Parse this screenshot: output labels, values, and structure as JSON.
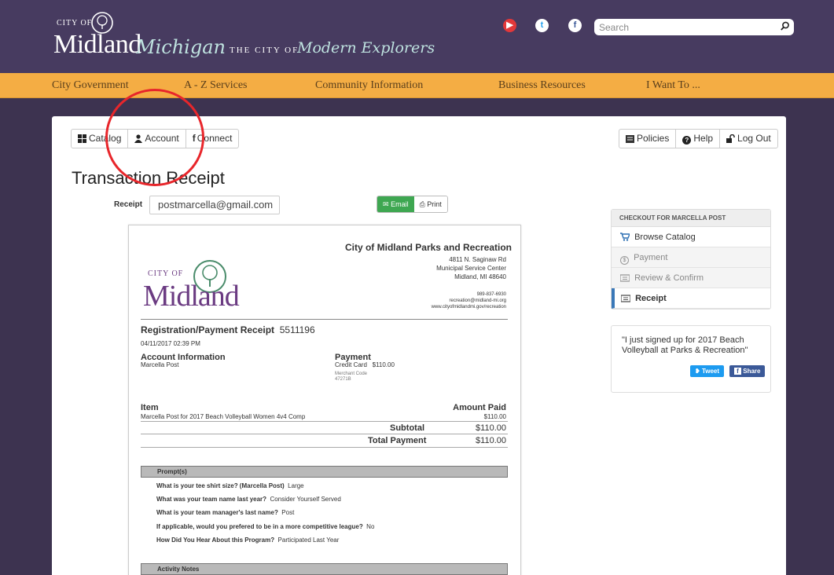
{
  "header": {
    "logo_cityof": "CITY OF",
    "logo_word": "Midland",
    "logo_script1": "Michigan",
    "logo_theof": "THE CITY OF",
    "logo_script2": "Modern Explorers",
    "social": [
      "youtube-icon",
      "twitter-icon",
      "facebook-icon"
    ],
    "search_placeholder": "Search"
  },
  "nav": {
    "items": [
      {
        "label": "City Government"
      },
      {
        "label": "A - Z Services"
      },
      {
        "label": "Community Information"
      },
      {
        "label": "Business Resources"
      },
      {
        "label": "I Want To ..."
      }
    ]
  },
  "toolbar": {
    "catalog": "Catalog",
    "account": "Account",
    "connect": "Connect",
    "policies": "Policies",
    "help": "Help",
    "logout": "Log Out"
  },
  "page": {
    "title": "Transaction Receipt",
    "receipt_label": "Receipt",
    "receipt_email": "postmarcella@gmail.com",
    "email_btn": "Email",
    "print_btn": "Print"
  },
  "doc": {
    "org_name": "City of Midland Parks and Recreation",
    "logo_cityof": "CITY OF",
    "logo_word": "Midland",
    "address": [
      "4811 N. Saginaw Rd",
      "Municipal Service Center",
      "Midland, MI 48640"
    ],
    "contact": [
      "989-837-6930",
      "recreation@midland-mi.org",
      "www.cityofmidlandmi.gov/recreation"
    ],
    "reg_title": "Registration/Payment Receipt",
    "reg_number": "5511196",
    "datetime": "04/11/2017 02:39 PM",
    "account_info_label": "Account Information",
    "account_name": "Marcella Post",
    "payment_label": "Payment",
    "payment_method": "Credit Card",
    "payment_amount": "$110.00",
    "merchant_code_label": "Merchant Code",
    "merchant_code": "47271B",
    "item_label": "Item",
    "amount_paid_label": "Amount Paid",
    "item_desc": "Marcella Post for 2017 Beach Volleyball Women 4v4 Comp",
    "item_amount": "$110.00",
    "subtotal_label": "Subtotal",
    "subtotal": "$110.00",
    "total_label": "Total Payment",
    "total": "$110.00",
    "prompts_label": "Prompt(s)",
    "prompts": [
      {
        "q": "What is your tee shirt size? (Marcella Post)",
        "a": "Large"
      },
      {
        "q": "What was your team name last year?",
        "a": "Consider Yourself Served"
      },
      {
        "q": "What is your team manager's last name?",
        "a": "Post"
      },
      {
        "q": "If applicable, would you prefered to be in a more competitive league?",
        "a": "No"
      },
      {
        "q": "How Did You Hear About this Program?",
        "a": "Participated Last Year"
      }
    ],
    "notes_label": "Activity Notes"
  },
  "sidebar": {
    "heading": "CHECKOUT FOR MARCELLA POST",
    "steps": [
      {
        "label": "Browse Catalog",
        "icon": "cart-icon"
      },
      {
        "label": "Payment",
        "icon": "dollar-icon"
      },
      {
        "label": "Review & Confirm",
        "icon": "ticket-icon"
      },
      {
        "label": "Receipt",
        "icon": "ticket-icon"
      }
    ]
  },
  "share": {
    "text": "\"I just signed up for 2017 Beach Volleyball at Parks & Recreation\"",
    "tweet": "Tweet",
    "share": "Share"
  },
  "colors": {
    "header_bg": "#473b60",
    "nav_bg": "#f4ad44",
    "email_green": "#3ea751",
    "annotation_red": "#e8262b"
  }
}
